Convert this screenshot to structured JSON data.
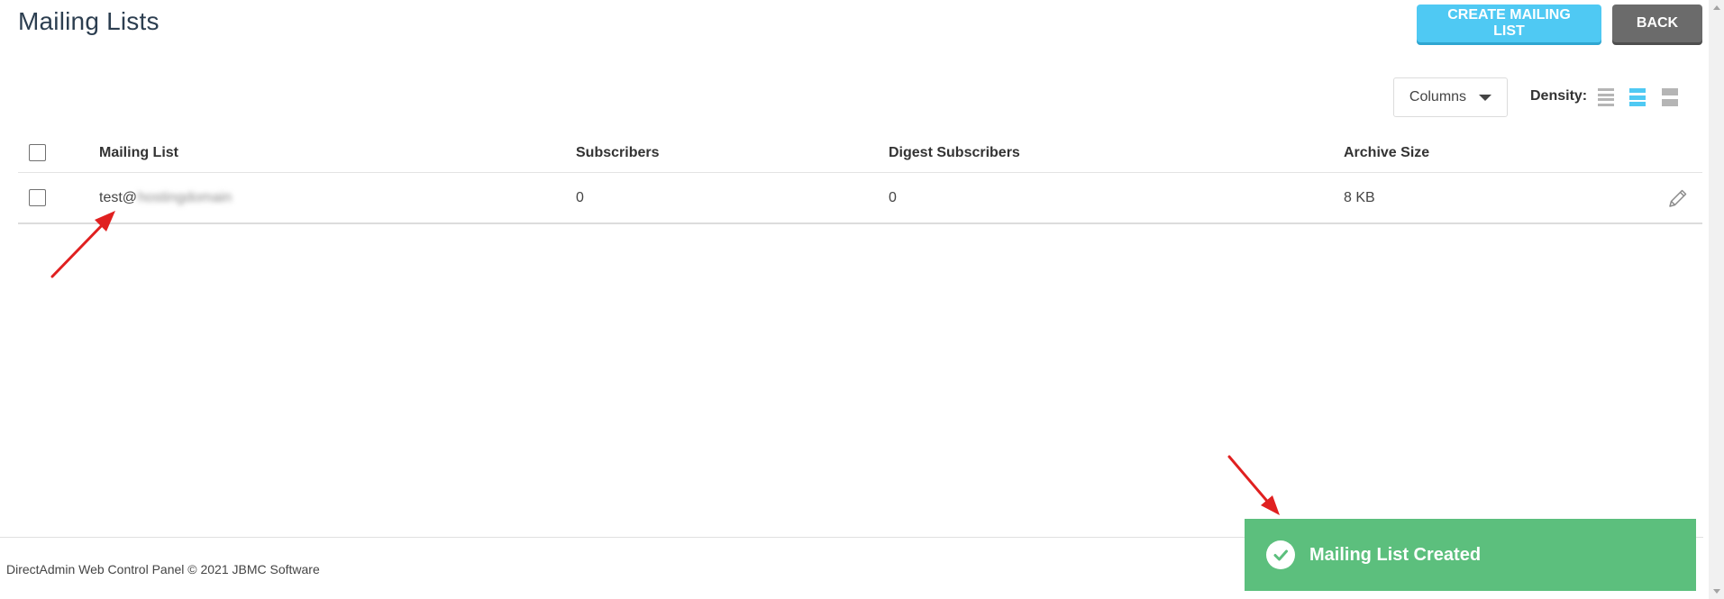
{
  "header": {
    "title": "Mailing Lists",
    "create_label": "CREATE MAILING LIST",
    "back_label": "BACK"
  },
  "controls": {
    "columns_label": "Columns",
    "density_label": "Density:"
  },
  "table": {
    "columns": [
      "Mailing List",
      "Subscribers",
      "Digest Subscribers",
      "Archive Size"
    ],
    "rows": [
      {
        "name_prefix": "test@",
        "name_blurred": "hostingdomain",
        "subscribers": "0",
        "digest_subscribers": "0",
        "archive_size": "8 KB"
      }
    ]
  },
  "footer": {
    "text": "DirectAdmin Web Control Panel © 2021 JBMC Software"
  },
  "toast": {
    "message": "Mailing List Created"
  },
  "colors": {
    "primary": "#4fc9f3",
    "back": "#6b6b6b",
    "success": "#5cbf7d",
    "annotation": "#e02020"
  }
}
